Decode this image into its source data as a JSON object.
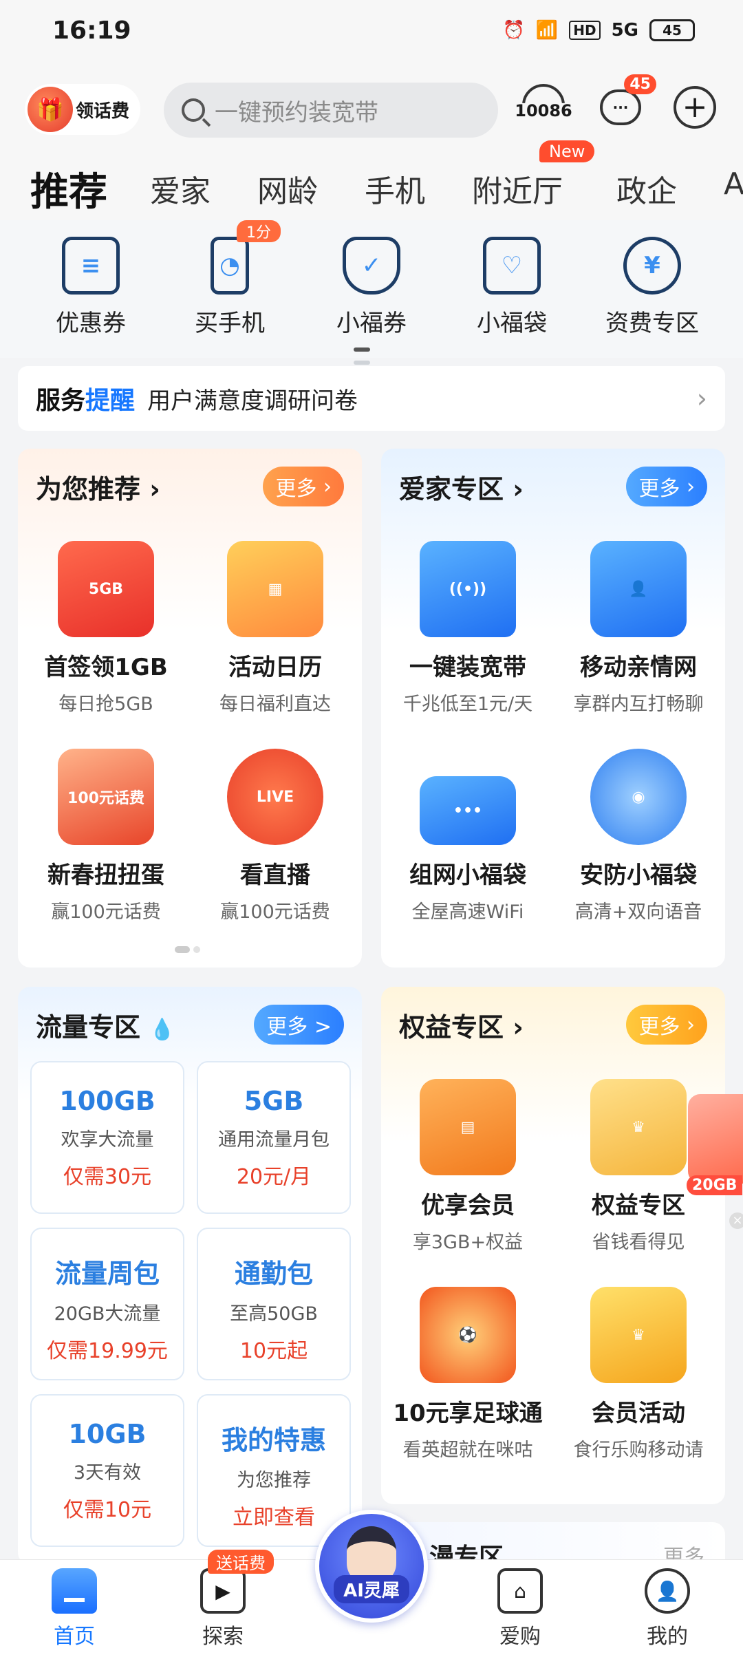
{
  "status_bar": {
    "time": "16:19",
    "network": "5G",
    "hd": "HD",
    "battery": "45"
  },
  "header": {
    "ling_fee": "领话费",
    "search_placeholder": "一键预约装宽带",
    "hotline": "10086",
    "message_badge": "45"
  },
  "tabs": {
    "items": [
      "推荐",
      "爱家",
      "网龄",
      "手机",
      "附近厅",
      "政企",
      "A"
    ],
    "new_badge": "New"
  },
  "quick": {
    "items": [
      {
        "label": "优惠券",
        "icon": "coupon-icon"
      },
      {
        "label": "买手机",
        "icon": "phone-icon"
      },
      {
        "label": "小福券",
        "icon": "fu-coupon-icon"
      },
      {
        "label": "小福袋",
        "icon": "fu-bag-icon"
      },
      {
        "label": "资费专区",
        "icon": "tariff-icon"
      }
    ],
    "tag": "1分"
  },
  "reminder": {
    "prefix1": "服务",
    "prefix2": "提醒",
    "text": "用户满意度调研问卷"
  },
  "recommend": {
    "title": "为您推荐",
    "more": "更多",
    "items": [
      {
        "title": "首签领1GB",
        "sub": "每日抢5GB",
        "img_text": "5GB"
      },
      {
        "title": "活动日历",
        "sub": "每日福利直达",
        "img_text": ""
      },
      {
        "title": "新春扭扭蛋",
        "sub": "赢100元话费",
        "img_text": "100元话费"
      },
      {
        "title": "看直播",
        "sub": "赢100元话费",
        "img_text": "LIVE"
      }
    ]
  },
  "home": {
    "title": "爱家专区",
    "more": "更多",
    "items": [
      {
        "title": "一键装宽带",
        "sub": "千兆低至1元/天"
      },
      {
        "title": "移动亲情网",
        "sub": "享群内互打畅聊"
      },
      {
        "title": "组网小福袋",
        "sub": "全屋高速WiFi"
      },
      {
        "title": "安防小福袋",
        "sub": "高清+双向语音"
      }
    ]
  },
  "flow": {
    "title": "流量专区",
    "more": "更多 >",
    "items": [
      {
        "value": "100GB",
        "desc": "欢享大流量",
        "price": "仅需30元"
      },
      {
        "value": "5GB",
        "desc": "通用流量月包",
        "price": "20元/月"
      },
      {
        "value": "流量周包",
        "desc": "20GB大流量",
        "price": "仅需19.99元"
      },
      {
        "value": "通勤包",
        "desc": "至高50GB",
        "price": "10元起"
      },
      {
        "value": "10GB",
        "desc": "3天有效",
        "price": "仅需10元"
      },
      {
        "value": "我的特惠",
        "desc": "为您推荐",
        "price": "立即查看"
      }
    ]
  },
  "rights": {
    "title": "权益专区",
    "more": "更多",
    "items": [
      {
        "title": "优享会员",
        "sub": "享3GB+权益"
      },
      {
        "title": "权益专区",
        "sub": "省钱看得见"
      },
      {
        "title": "10元享足球通",
        "sub": "看英超就在咪咕"
      },
      {
        "title": "会员活动",
        "sub": "食行乐购移动请"
      }
    ],
    "float_tag": "20GB"
  },
  "peek_card": {
    "title": "漫专区",
    "more": "更多"
  },
  "bottom_nav": {
    "items": [
      {
        "label": "首页"
      },
      {
        "label": "探索"
      },
      {
        "label": "爱购"
      },
      {
        "label": "我的"
      }
    ],
    "ai_label": "AI灵犀",
    "gift_tag": "送话费"
  }
}
